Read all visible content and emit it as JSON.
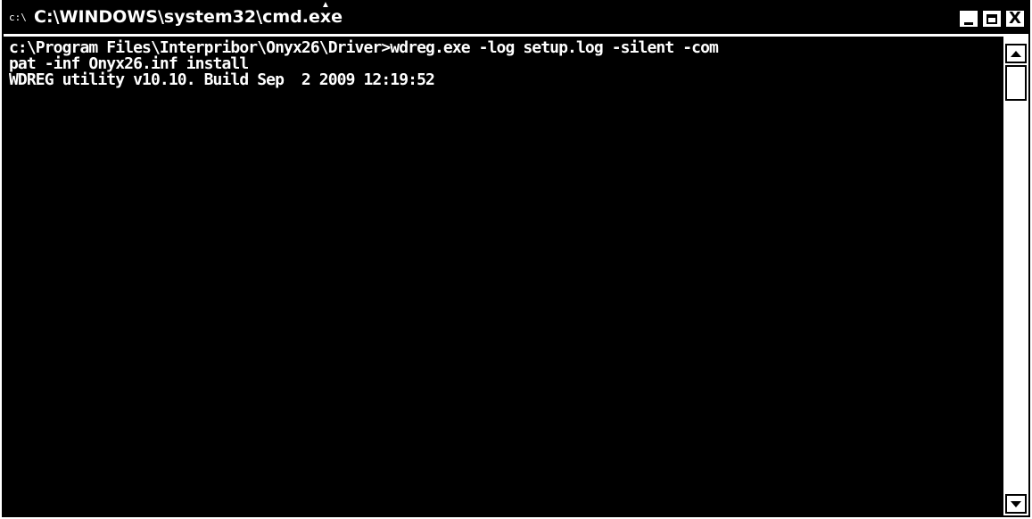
{
  "window": {
    "title": "C:\\WINDOWS\\system32\\cmd.exe",
    "icon": "cmd-icon",
    "controls": {
      "minimize": "minimize-icon",
      "maximize": "maximize-icon",
      "close_label": "X"
    }
  },
  "console": {
    "lines": [
      "c:\\Program Files\\Interpribor\\Onyx26\\Driver>wdreg.exe -log setup.log -silent -com",
      "pat -inf Onyx26.inf install",
      "WDREG utility v10.10. Build Sep  2 2009 12:19:52"
    ]
  },
  "colors": {
    "background": "#000000",
    "foreground": "#ffffff"
  }
}
